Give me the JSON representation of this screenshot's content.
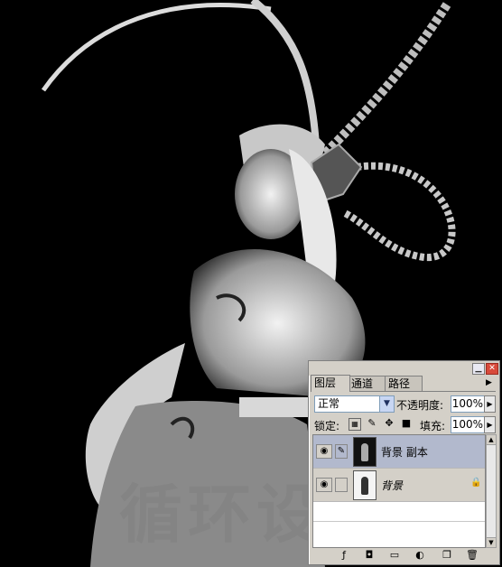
{
  "watermark": {
    "text": "循环设计"
  },
  "layers_panel": {
    "tabs": [
      {
        "label": "图层",
        "active": true
      },
      {
        "label": "通道",
        "active": false
      },
      {
        "label": "路径",
        "active": false
      }
    ],
    "blend_mode": "正常",
    "opacity_label": "不透明度:",
    "opacity_value": "100%",
    "lock_label": "锁定:",
    "fill_label": "填充:",
    "fill_value": "100%",
    "layers": [
      {
        "name": "背景 副本",
        "visible": true,
        "selected": true
      },
      {
        "name": "背景",
        "visible": true,
        "selected": false,
        "locked": true
      }
    ],
    "colors": {
      "selected_row": "#b2b9cd",
      "panel_bg": "#d4d0c8",
      "close_button": "#d84a3a"
    },
    "bottom_icons": [
      "link-layers-icon",
      "add-style-icon",
      "add-mask-icon",
      "new-group-icon",
      "adjustment-layer-icon",
      "new-layer-icon",
      "delete-layer-icon"
    ]
  }
}
